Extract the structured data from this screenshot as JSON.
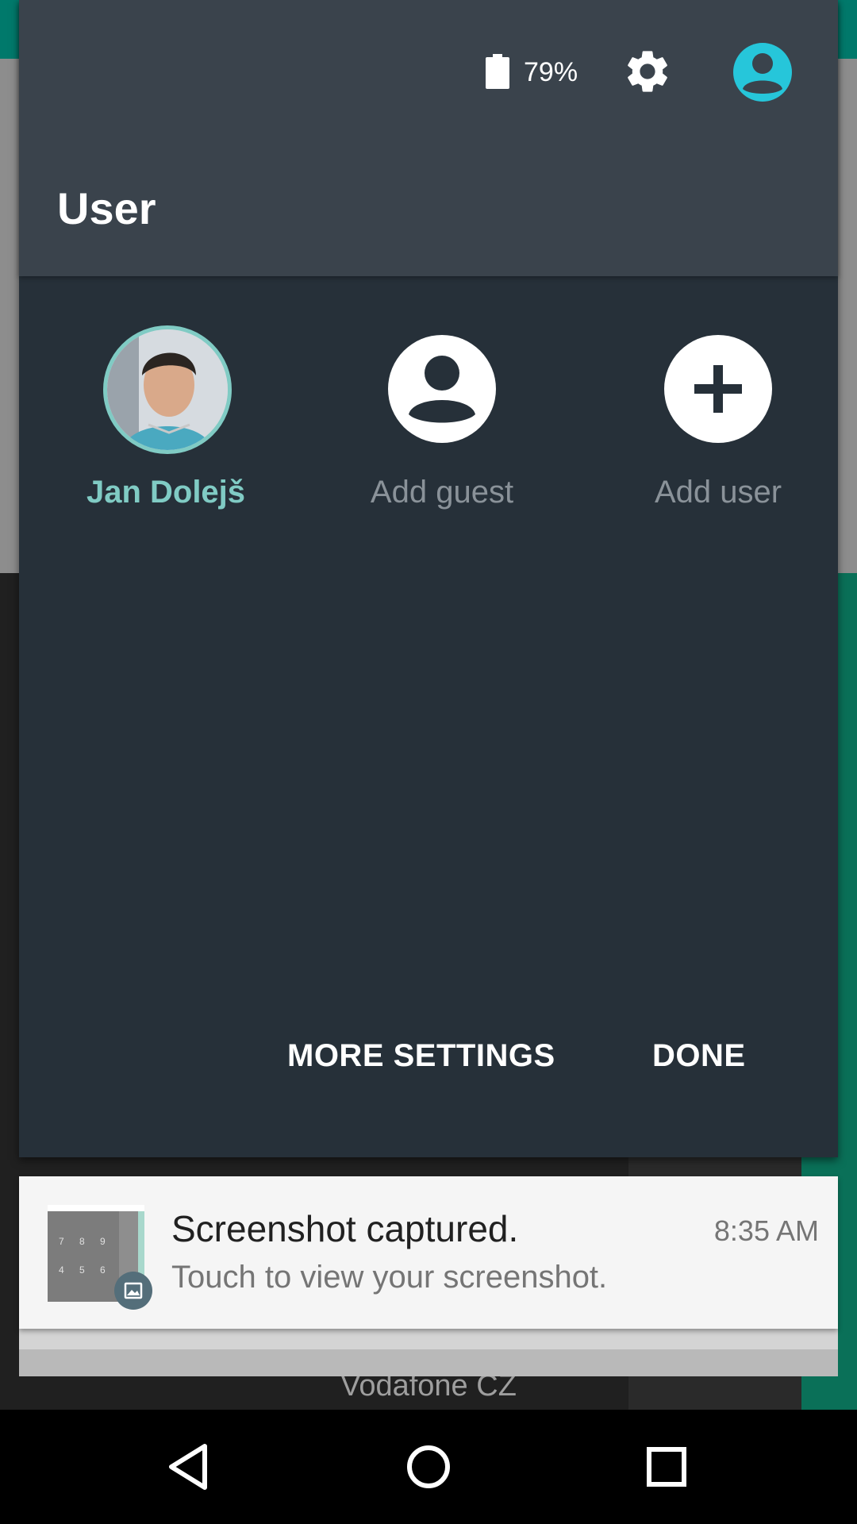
{
  "status": {
    "battery_percent": "79%"
  },
  "panel": {
    "title": "User",
    "users": [
      {
        "label": "Jan Dolejš",
        "active": true
      },
      {
        "label": "Add guest",
        "active": false
      },
      {
        "label": "Add user",
        "active": false
      }
    ],
    "buttons": {
      "more_settings": "MORE SETTINGS",
      "done": "DONE"
    }
  },
  "notification": {
    "title": "Screenshot captured.",
    "time": "8:35 AM",
    "text": "Touch to view your screenshot.",
    "thumb_keys": [
      "7",
      "8",
      "9",
      "4",
      "5",
      "6"
    ]
  },
  "background": {
    "carrier": "Vodafone CZ"
  },
  "colors": {
    "accent": "#80cbc4",
    "panel_bg": "#263039",
    "header_bg": "#3a434c",
    "account_icon": "#26c6da"
  },
  "icons": [
    "battery-icon",
    "gear-icon",
    "account-circle-icon",
    "person-icon",
    "add-icon",
    "image-icon",
    "back-icon",
    "home-icon",
    "recents-icon"
  ]
}
